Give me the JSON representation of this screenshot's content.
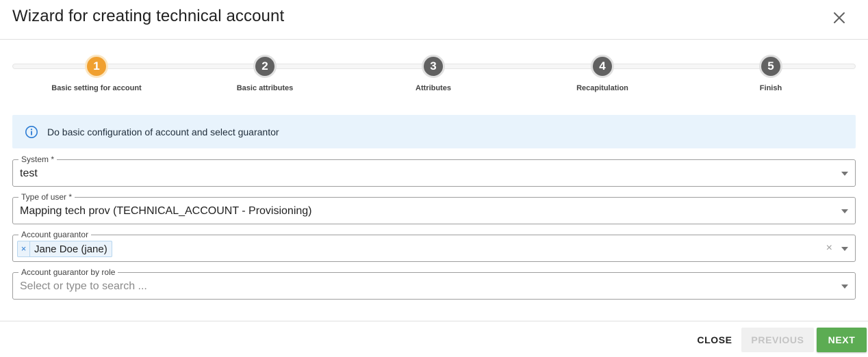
{
  "dialog": {
    "title": "Wizard for creating technical account"
  },
  "stepper": {
    "steps": [
      {
        "number": "1",
        "label": "Basic setting for account",
        "state": "active"
      },
      {
        "number": "2",
        "label": "Basic attributes",
        "state": "inactive"
      },
      {
        "number": "3",
        "label": "Attributes",
        "state": "inactive"
      },
      {
        "number": "4",
        "label": "Recapitulation",
        "state": "inactive"
      },
      {
        "number": "5",
        "label": "Finish",
        "state": "inactive"
      }
    ]
  },
  "info": {
    "text": "Do basic configuration of account and select guarantor",
    "icon": "info-icon"
  },
  "form": {
    "system": {
      "label": "System *",
      "value": "test"
    },
    "user_type": {
      "label": "Type of user *",
      "value": "Mapping tech prov (TECHNICAL_ACCOUNT - Provisioning)"
    },
    "guarantor": {
      "label": "Account guarantor",
      "chips": [
        "Jane Doe (jane)"
      ],
      "chip_remove": "×",
      "clear": "×"
    },
    "guarantor_role": {
      "label": "Account guarantor by role",
      "placeholder": "Select or type to search ..."
    }
  },
  "footer": {
    "close_label": "CLOSE",
    "previous_label": "PREVIOUS",
    "next_label": "NEXT"
  },
  "colors": {
    "active_step": "#f0a030",
    "inactive_step": "#616161",
    "info_background": "#e8f3fc",
    "next_button": "#5cac53"
  }
}
